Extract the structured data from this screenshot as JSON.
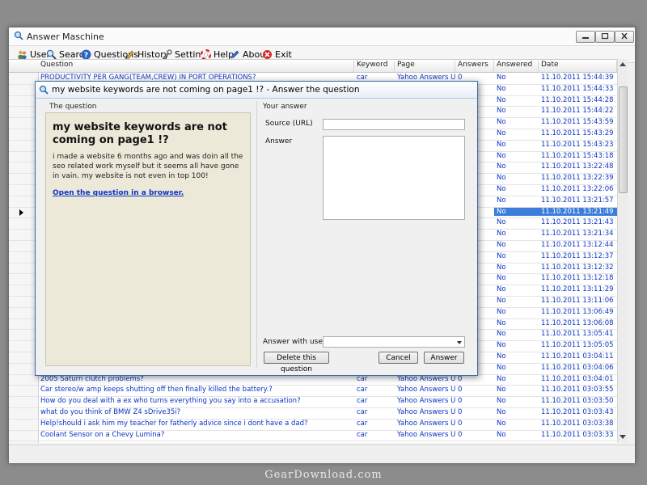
{
  "window": {
    "title": "Answer Maschine"
  },
  "toolbar": {
    "items": [
      {
        "label": "User",
        "icon": "users-icon"
      },
      {
        "label": "Search",
        "icon": "search-icon"
      },
      {
        "label": "Questions",
        "icon": "help-circle-icon"
      },
      {
        "label": "History",
        "icon": "history-icon"
      },
      {
        "label": "Settings",
        "icon": "wrench-icon"
      },
      {
        "label": "Help",
        "icon": "lifebuoy-icon"
      },
      {
        "label": "About",
        "icon": "pencil-icon"
      },
      {
        "label": "Exit",
        "icon": "exit-icon"
      }
    ]
  },
  "grid": {
    "columns": [
      "Question",
      "Keyword",
      "Page",
      "Answers",
      "Answered",
      "Date"
    ],
    "rows": [
      [
        "PRODUCTIVITY PER GANG(TEAM,CREW) IN PORT OPERATIONS?",
        "car",
        "Yahoo Answers UK",
        "0",
        "No",
        "11.10.2011 15:44:39"
      ],
      [
        "",
        "",
        "",
        "",
        "No",
        "11.10.2011 15:44:33"
      ],
      [
        "",
        "",
        "",
        "",
        "No",
        "11.10.2011 15:44:28"
      ],
      [
        "",
        "",
        "",
        "",
        "No",
        "11.10.2011 15:44:22"
      ],
      [
        "",
        "",
        "",
        "",
        "No",
        "11.10.2011 15:43:59"
      ],
      [
        "",
        "",
        "",
        "",
        "No",
        "11.10.2011 15:43:29"
      ],
      [
        "",
        "",
        "",
        "",
        "No",
        "11.10.2011 15:43:23"
      ],
      [
        "",
        "",
        "",
        "",
        "No",
        "11.10.2011 15:43:18"
      ],
      [
        "",
        "",
        "",
        "",
        "No",
        "11.10.2011 13:22:48"
      ],
      [
        "",
        "",
        "",
        "",
        "No",
        "11.10.2011 13:22:39"
      ],
      [
        "",
        "",
        "",
        "",
        "No",
        "11.10.2011 13:22:06"
      ],
      [
        "",
        "",
        "",
        "",
        "No",
        "11.10.2011 13:21:57"
      ],
      [
        "",
        "",
        "",
        "",
        "No",
        "11.10.2011 13:21:49"
      ],
      [
        "",
        "",
        "",
        "",
        "No",
        "11.10.2011 13:21:43"
      ],
      [
        "",
        "",
        "",
        "",
        "No",
        "11.10.2011 13:21:34"
      ],
      [
        "",
        "",
        "",
        "",
        "No",
        "11.10.2011 13:12:44"
      ],
      [
        "",
        "",
        "",
        "",
        "No",
        "11.10.2011 13:12:37"
      ],
      [
        "",
        "",
        "",
        "",
        "No",
        "11.10.2011 13:12:32"
      ],
      [
        "",
        "",
        "",
        "",
        "No",
        "11.10.2011 13:12:18"
      ],
      [
        "",
        "",
        "",
        "",
        "No",
        "11.10.2011 13:11:29"
      ],
      [
        "",
        "",
        "",
        "",
        "No",
        "11.10.2011 13:11:06"
      ],
      [
        "",
        "",
        "",
        "",
        "No",
        "11.10.2011 13:06:49"
      ],
      [
        "",
        "",
        "",
        "",
        "No",
        "11.10.2011 13:06:08"
      ],
      [
        "",
        "",
        "",
        "",
        "No",
        "11.10.2011 13:05:41"
      ],
      [
        "",
        "",
        "",
        "",
        "No",
        "11.10.2011 13:05:05"
      ],
      [
        "",
        "",
        "",
        "",
        "No",
        "11.10.2011 03:04:11"
      ],
      [
        "",
        "",
        "",
        "",
        "No",
        "11.10.2011 03:04:06"
      ],
      [
        "2005 Saturn clutch problems?",
        "car",
        "Yahoo Answers UK",
        "0",
        "No",
        "11.10.2011 03:04:01"
      ],
      [
        "Car stereo/w amp keeps shutting off then finally killed the battery.?",
        "car",
        "Yahoo Answers UK",
        "0",
        "No",
        "11.10.2011 03:03:55"
      ],
      [
        "How do you deal with a ex who turns everything you say into a accusation?",
        "car",
        "Yahoo Answers UK",
        "0",
        "No",
        "11.10.2011 03:03:50"
      ],
      [
        "what do you think of BMW Z4 sDrive35i?",
        "car",
        "Yahoo Answers UK",
        "0",
        "No",
        "11.10.2011 03:03:43"
      ],
      [
        "Help!should i ask him my teacher for fatherly advice since i dont have a dad?",
        "car",
        "Yahoo Answers UK",
        "0",
        "No",
        "11.10.2011 03:03:38"
      ],
      [
        "Coolant Sensor on a Chevy Lumina?",
        "car",
        "Yahoo Answers UK",
        "0",
        "No",
        "11.10.2011 03:03:33"
      ]
    ],
    "selected_row": 12
  },
  "dialog": {
    "title": "my website keywords are not coming on page1 !? - Answer the question",
    "question_section": "The question",
    "answer_section": "Your answer",
    "question_title": "my website keywords are not coming on page1 !?",
    "question_body": "i made a website 6 months ago and was doin all the seo related work myself but it seems all have gone in vain. my website is not even in top 100!",
    "open_link": "Open the question in a browser.",
    "source_label": "Source (URL)",
    "source_value": "",
    "answer_label": "Answer",
    "answer_value": "",
    "answer_with_user_label": "Answer with user",
    "answer_with_user_value": "",
    "delete_button": "Delete this question",
    "cancel_button": "Cancel",
    "answer_button": "Answer"
  },
  "watermark": "GearDownload.com",
  "colors": {
    "link": "#0b34c4",
    "selection": "#3b7ddb",
    "question_panel": "#ece9d8"
  }
}
